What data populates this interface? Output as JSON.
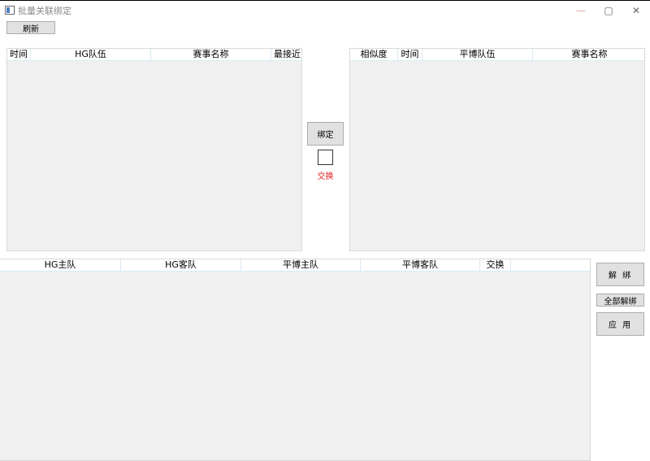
{
  "window": {
    "title": "批量关联绑定",
    "minimize": "—",
    "maximize": "▢",
    "close": "✕"
  },
  "toolbar": {
    "refresh_label": "刷新"
  },
  "hg_table": {
    "columns": [
      "时间",
      "HG队伍",
      "赛事名称",
      "最接近"
    ]
  },
  "pb_table": {
    "columns": [
      "相似度",
      "时间",
      "平博队伍",
      "赛事名称"
    ]
  },
  "center": {
    "bind_label": "绑定",
    "swap_label": "交换",
    "swap_checked": false
  },
  "bind_table": {
    "columns": [
      "HG主队",
      "HG客队",
      "平博主队",
      "平博客队",
      "交换",
      ""
    ]
  },
  "side": {
    "unbind_label": "解 绑",
    "unbind_all_label": "全部解绑",
    "apply_label": "应 用"
  }
}
